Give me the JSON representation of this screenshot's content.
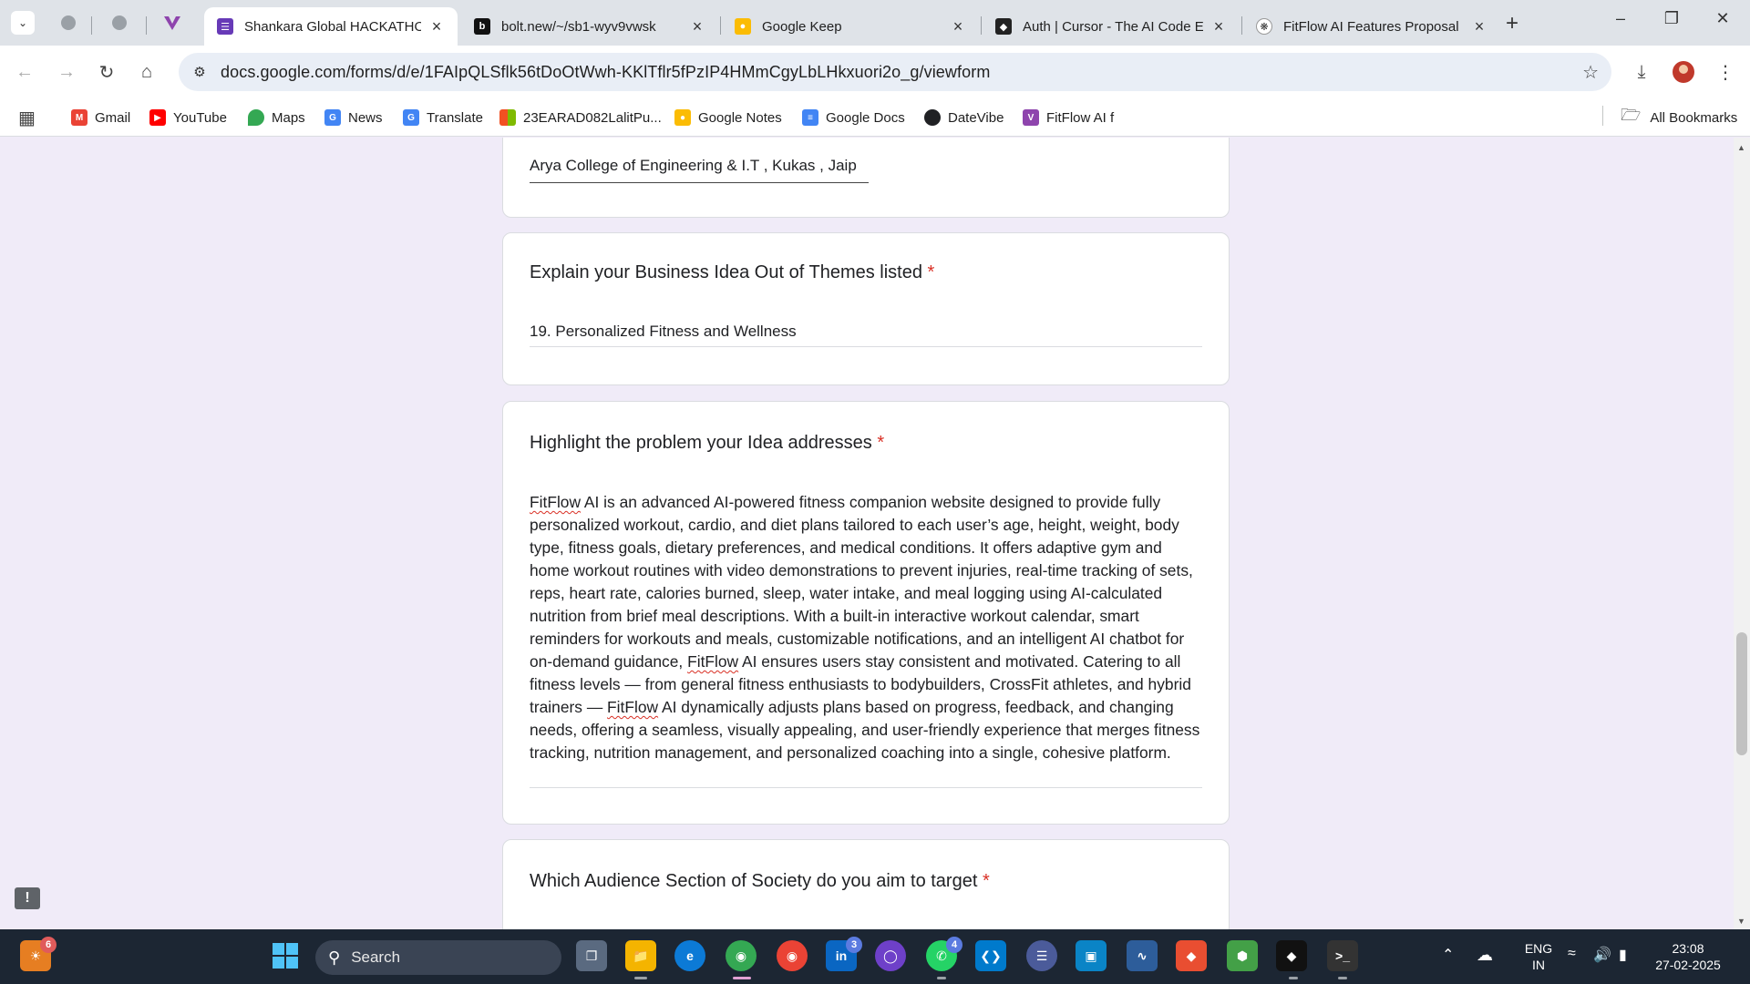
{
  "browser": {
    "tabs": [
      {
        "title": "Shankara Global HACKATHON",
        "active": true,
        "icon": "google-forms-icon"
      },
      {
        "title": "bolt.new/~/sb1-wyv9vwsk",
        "active": false,
        "icon": "bolt-icon"
      },
      {
        "title": "Google Keep",
        "active": false,
        "icon": "google-keep-icon"
      },
      {
        "title": "Auth | Cursor - The AI Code Editor",
        "active": false,
        "icon": "cursor-icon"
      },
      {
        "title": "FitFlow AI Features Proposal",
        "active": false,
        "icon": "openai-icon"
      }
    ],
    "url": "docs.google.com/forms/d/e/1FAIpQLSflk56tDoOtWwh-KKlTflr5fPzIP4HMmCgyLbLHkxuori2o_g/viewform",
    "bookmarks": [
      {
        "label": "Gmail",
        "icon": "gmail-icon",
        "color": "#ea4335"
      },
      {
        "label": "YouTube",
        "icon": "youtube-icon",
        "color": "#ff0000"
      },
      {
        "label": "Maps",
        "icon": "maps-icon",
        "color": "#34a853"
      },
      {
        "label": "News",
        "icon": "news-icon",
        "color": "#4285f4"
      },
      {
        "label": "Translate",
        "icon": "translate-icon",
        "color": "#4285f4"
      },
      {
        "label": "23EARAD082LalitPu...",
        "icon": "microsoft-icon",
        "color": "#f25022"
      },
      {
        "label": "Google Notes",
        "icon": "keep-icon",
        "color": "#fbbc04"
      },
      {
        "label": "Google Docs",
        "icon": "docs-icon",
        "color": "#4285f4"
      },
      {
        "label": "DateVibe",
        "icon": "globe-icon",
        "color": "#202124"
      },
      {
        "label": "FitFlow AI f",
        "icon": "vercel-icon",
        "color": "#8e44ad"
      }
    ],
    "all_bookmarks": "All Bookmarks"
  },
  "form": {
    "college_answer": "Arya College of Engineering & I.T , Kukas , Jaip",
    "q_business": {
      "title": "Explain your Business Idea Out of Themes listed",
      "required": "*",
      "answer": "19. Personalized Fitness and Wellness"
    },
    "q_problem": {
      "title": "Highlight the problem your Idea addresses",
      "required": "*",
      "answer_parts": [
        "FitFlow",
        " AI is an advanced AI-powered fitness companion website designed to provide fully personalized workout, cardio, and diet plans tailored to each user’s age, height, weight, body type, fitness goals, dietary preferences, and medical conditions. It offers adaptive gym and home workout routines with video demonstrations to prevent injuries, real-time tracking of sets, reps, heart rate, calories burned, sleep, water intake, and meal logging using AI-calculated nutrition from brief meal descriptions. With a built-in interactive workout calendar, smart reminders for workouts and meals, customizable notifications, and an intelligent AI chatbot for on-demand guidance, ",
        "FitFlow",
        " AI ensures users stay consistent and motivated. Catering to all fitness levels — from general fitness enthusiasts to bodybuilders, CrossFit athletes, and hybrid trainers — ",
        "FitFlow",
        " AI dynamically adjusts plans based on progress, feedback, and changing needs, offering a seamless, visually appealing, and user-friendly experience that merges fitness tracking, nutrition management, and personalized coaching into a single, cohesive platform."
      ]
    },
    "q_audience": {
      "title": "Which Audience Section of Society do you aim to target",
      "required": "*"
    }
  },
  "taskbar": {
    "search_label": "Search",
    "badges": {
      "weather": "6",
      "linkedin": "3",
      "whatsapp": "4"
    },
    "lang_top": "ENG",
    "lang_bottom": "IN",
    "time": "23:08",
    "date": "27-02-2025"
  }
}
